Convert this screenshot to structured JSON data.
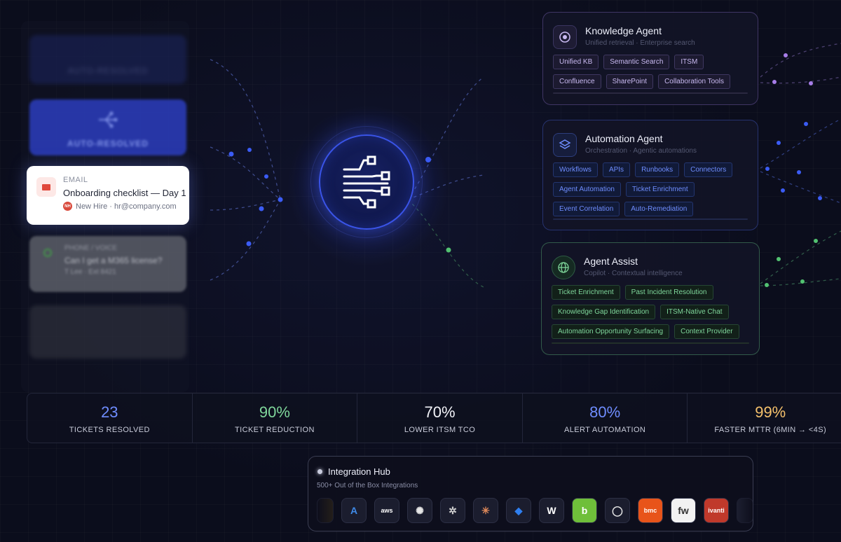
{
  "queue": {
    "faded_top_label": "AUTO-RESOLVED",
    "auto_resolved_label": "AUTO-RESOLVED",
    "email": {
      "channel": "EMAIL",
      "subject": "Onboarding checklist — Day 1",
      "avatar_initials": "NH",
      "from": "New Hire · hr@company.com"
    },
    "phone": {
      "channel": "PHONE / VOICE",
      "subject": "Can I get a M365 license?",
      "from": "T Lee · Ext 8421"
    }
  },
  "agents": {
    "knowledge": {
      "title": "Knowledge Agent",
      "subtitle": "Unified retrieval · Enterprise search",
      "icon": "target-icon",
      "tags": [
        "Unified KB",
        "Semantic Search",
        "ITSM",
        "Confluence",
        "SharePoint",
        "Collaboration Tools"
      ]
    },
    "automation": {
      "title": "Automation Agent",
      "subtitle": "Orchestration · Agentic automations",
      "icon": "layers-icon",
      "tags": [
        "Workflows",
        "APIs",
        "Runbooks",
        "Connectors",
        "Agent Automation",
        "Ticket Enrichment",
        "Event Correlation",
        "Auto-Remediation"
      ]
    },
    "assist": {
      "title": "Agent Assist",
      "subtitle": "Copilot · Contextual intelligence",
      "icon": "globe-icon",
      "tags": [
        "Ticket Enrichment",
        "Past Incident Resolution",
        "Knowledge Gap Identification",
        "ITSM-Native Chat",
        "Automation Opportunity Surfacing",
        "Context Provider"
      ]
    }
  },
  "metrics": [
    {
      "value": "23",
      "label": "TICKETS RESOLVED",
      "color": "#6f8dff"
    },
    {
      "value": "90%",
      "label": "TICKET REDUCTION",
      "color": "#7fd79b"
    },
    {
      "value": "70%",
      "label": "LOWER ITSM TCO",
      "color": "#f2f3f8"
    },
    {
      "value": "80%",
      "label": "ALERT AUTOMATION",
      "color": "#6f8dff"
    },
    {
      "value": "99%",
      "label": "FASTER MTTR (6MIN → <4S)",
      "color": "#f5c16c"
    }
  ],
  "integration_hub": {
    "title": "Integration Hub",
    "subtitle": "500+ Out of the Box Integrations",
    "logos": [
      {
        "name": "azure",
        "text": "A",
        "color": "#3f8ae8"
      },
      {
        "name": "aws",
        "text": "aws",
        "color": "#ffffff"
      },
      {
        "name": "openai",
        "text": "✺",
        "color": "#e6e6e6"
      },
      {
        "name": "bug",
        "text": "✲",
        "color": "#cfcfcf"
      },
      {
        "name": "claude",
        "text": "✳",
        "color": "#e08a5a"
      },
      {
        "name": "jira",
        "text": "◆",
        "color": "#2f7ff0"
      },
      {
        "name": "workday",
        "text": "W",
        "color": "#ffffff"
      },
      {
        "name": "bamboo",
        "text": "b",
        "color": "#ffffff"
      },
      {
        "name": "okta",
        "text": "◯",
        "color": "#e6e6e6"
      },
      {
        "name": "bmc",
        "text": "bmc",
        "color": "#ffffff"
      },
      {
        "name": "freshworks",
        "text": "fw",
        "color": "#333333"
      },
      {
        "name": "ivanti",
        "text": "ivanti",
        "color": "#ffffff"
      }
    ]
  }
}
